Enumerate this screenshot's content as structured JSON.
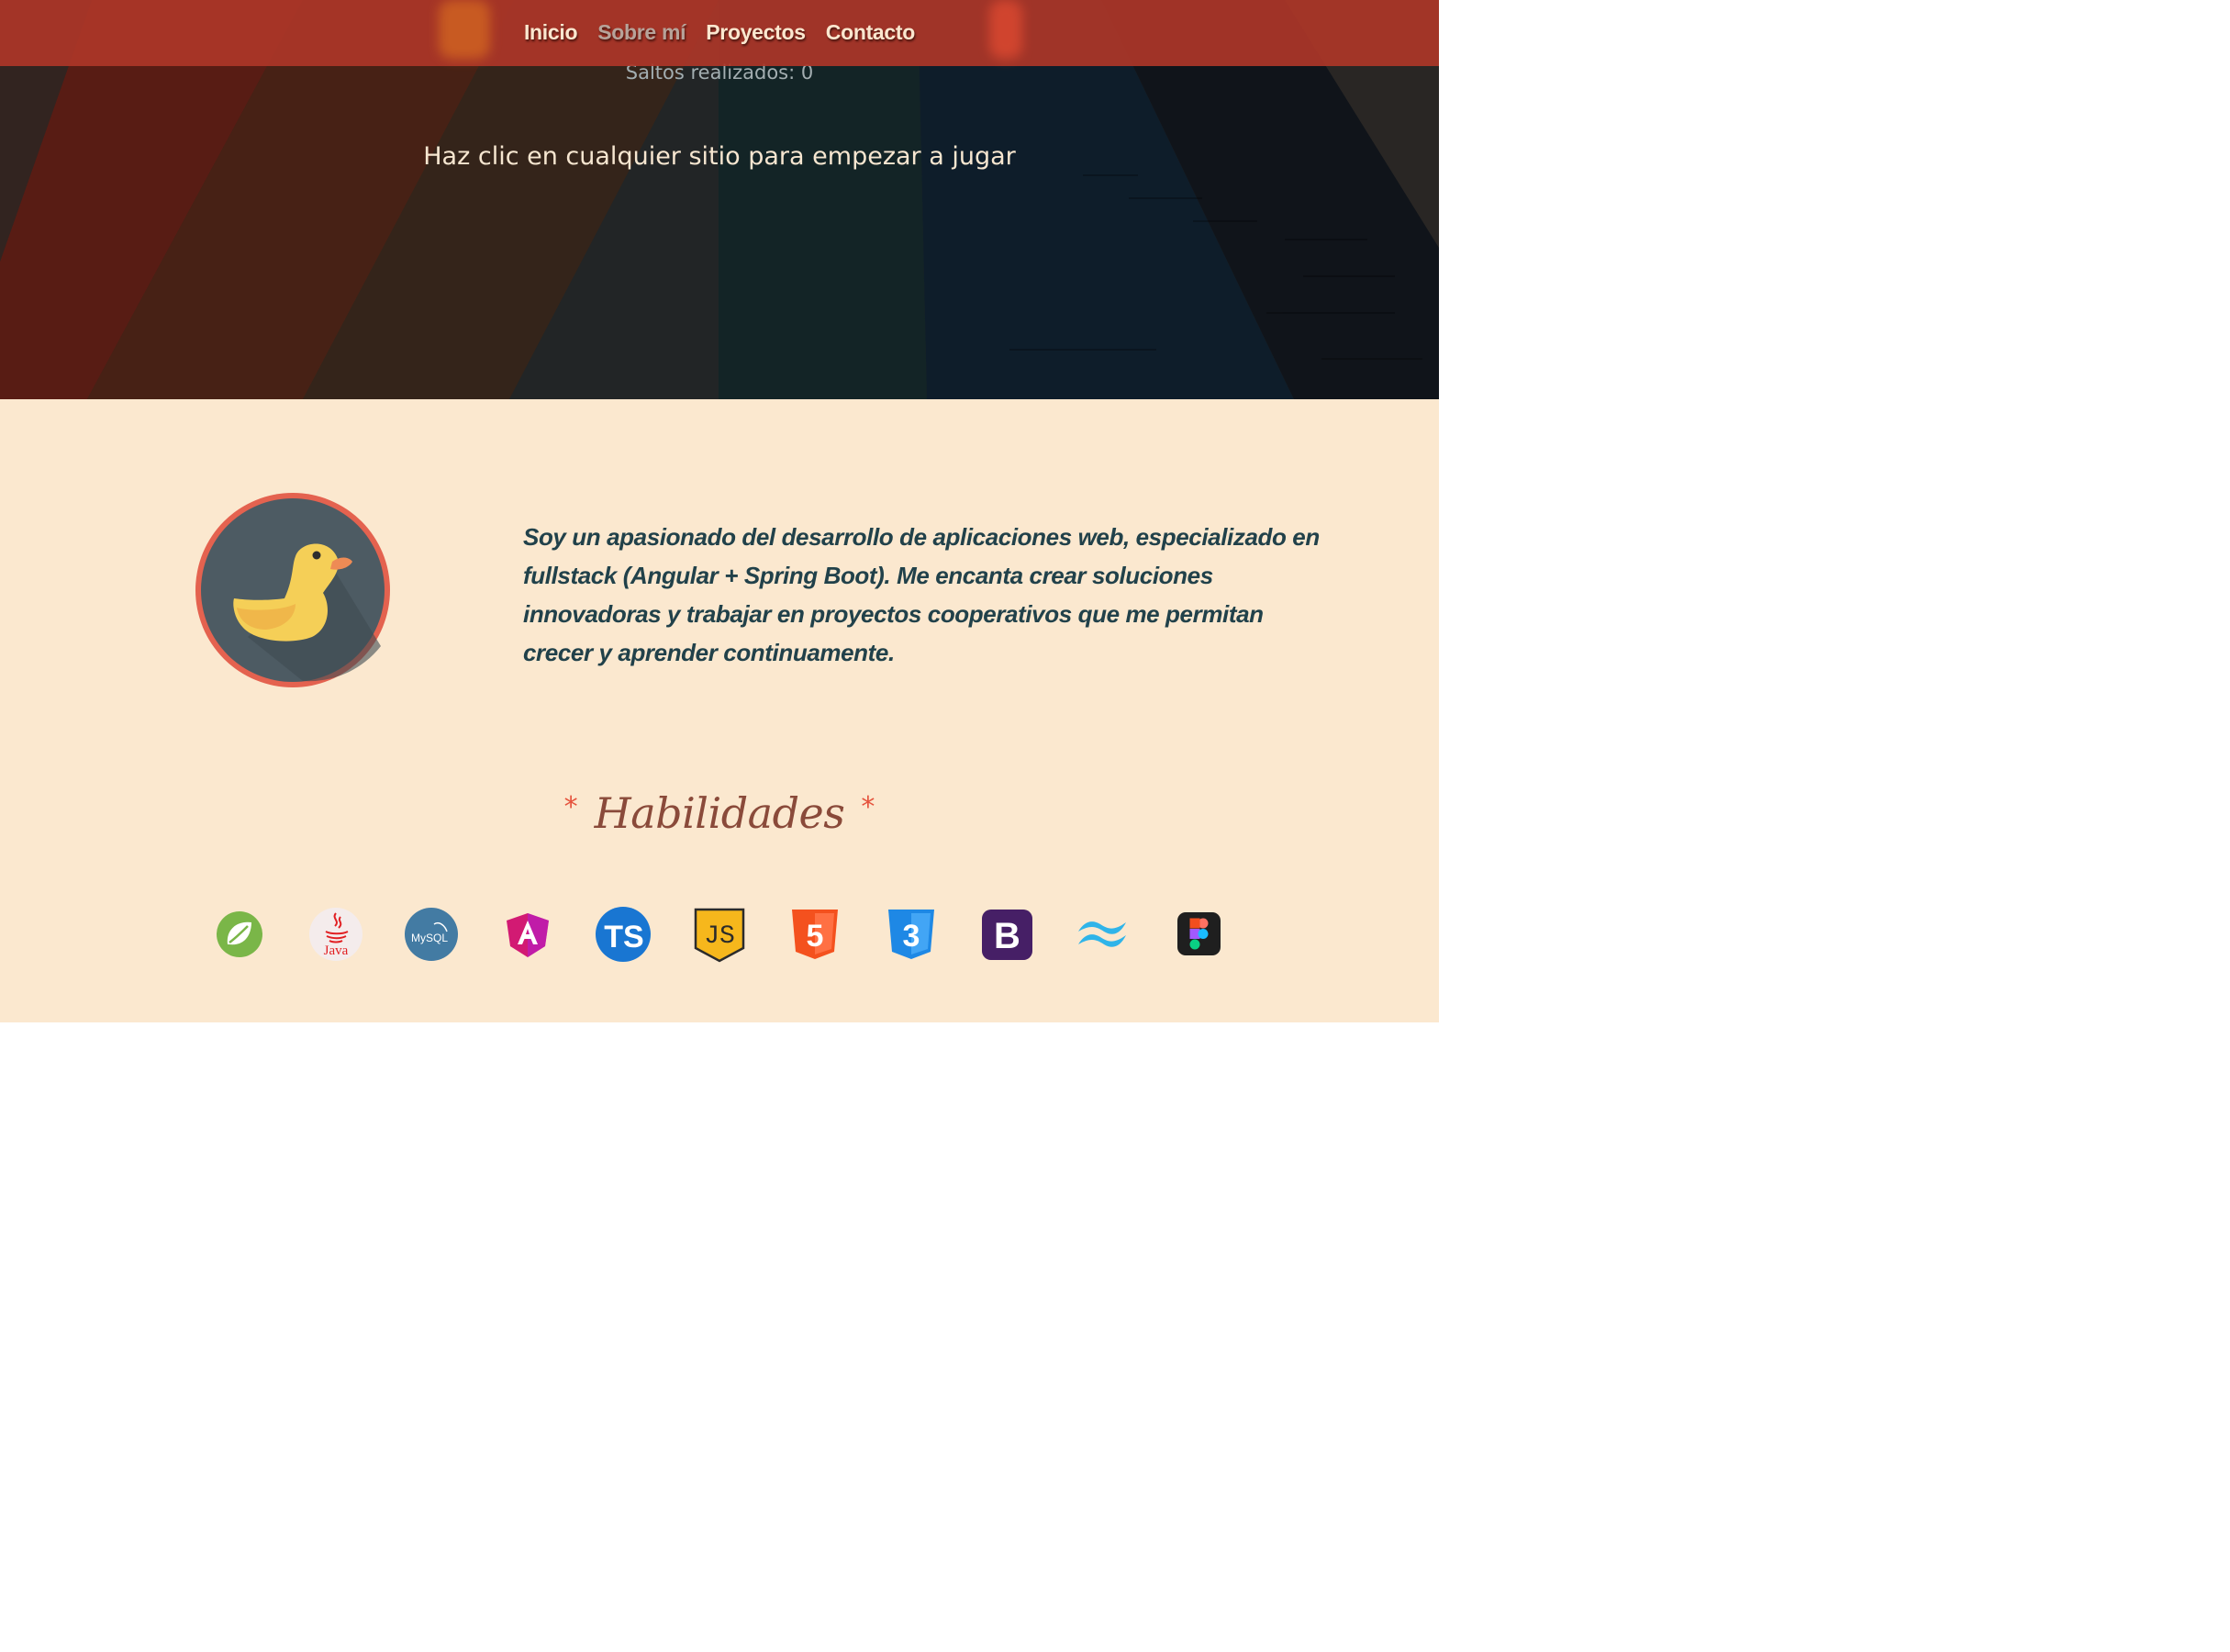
{
  "nav": {
    "items": [
      {
        "label": "Inicio",
        "active": false
      },
      {
        "label": "Sobre mí",
        "active": true
      },
      {
        "label": "Proyectos",
        "active": false
      },
      {
        "label": "Contacto",
        "active": false
      }
    ]
  },
  "hero": {
    "jump_counter": "Saltos realizados: 0",
    "play_hint": "Haz clic en cualquier sitio para empezar a jugar"
  },
  "about": {
    "avatar_icon": "duck-icon",
    "description": "Soy un apasionado del desarrollo de aplicaciones web, especializado en fullstack (Angular + Spring Boot). Me encanta crear soluciones innovadoras y trabajar en proyectos cooperativos que me permitan crecer y aprender continuamente."
  },
  "skills": {
    "asterisk": "*",
    "title": "Habilidades",
    "icons": [
      "spring-icon",
      "java-icon",
      "mysql-icon",
      "angular-icon",
      "typescript-icon",
      "javascript-icon",
      "html5-icon",
      "css3-icon",
      "bootstrap-icon",
      "tailwind-icon",
      "figma-icon"
    ],
    "java_label": "Java",
    "mysql_label": "MySQL",
    "ts_label": "TS",
    "js_label": "JS",
    "html_label": "5",
    "css_label": "3",
    "bootstrap_label": "B"
  },
  "colors": {
    "navbar": "#ac3628",
    "nav_text": "#fbe7cf",
    "section_bg": "#fbe8cf",
    "about_text": "#21414a",
    "accent": "#e5533d",
    "skills_title": "#8a4a3a"
  }
}
